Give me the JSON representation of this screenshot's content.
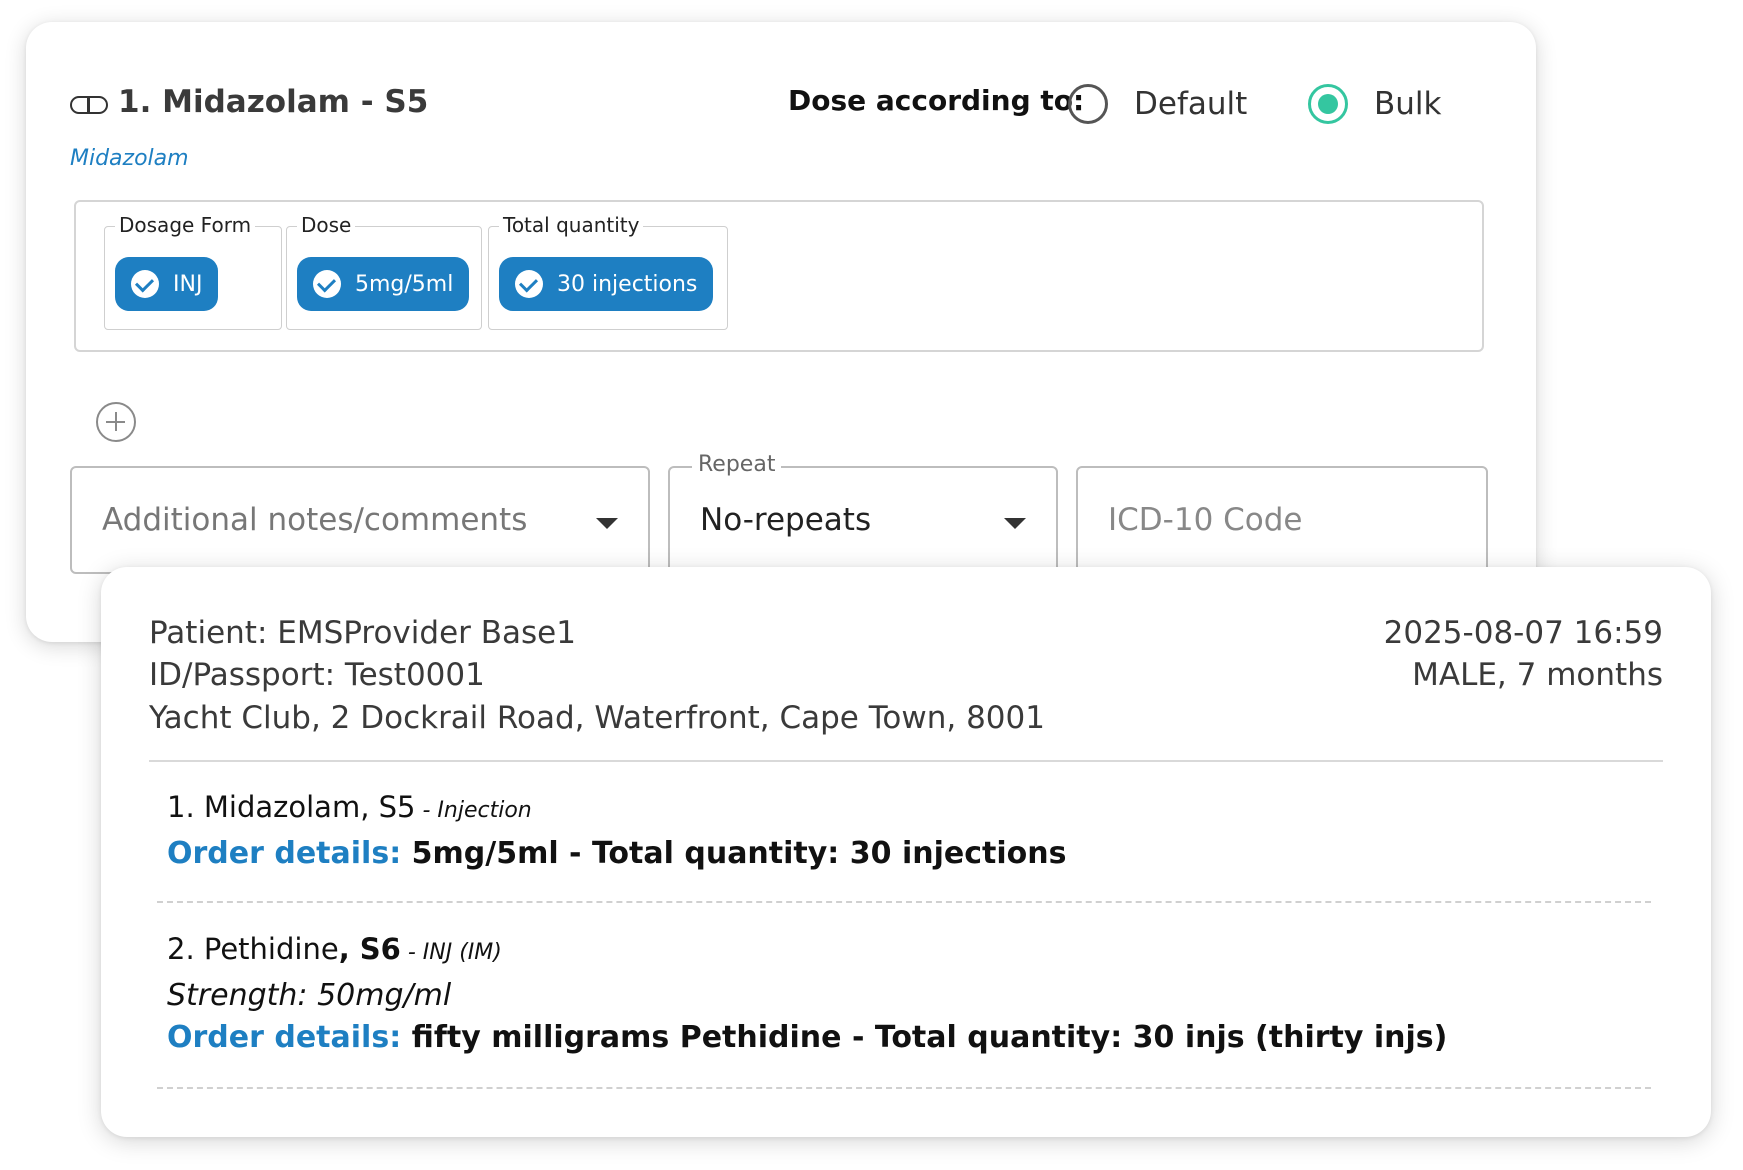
{
  "editor": {
    "med_title": "1. Midazolam - S5",
    "med_generic": "Midazolam",
    "dose_according_label": "Dose according to:",
    "dose_options": [
      {
        "label": "Default",
        "selected": false
      },
      {
        "label": "Bulk",
        "selected": true
      }
    ],
    "fields": {
      "dosage_form": {
        "legend": "Dosage Form",
        "value": "INJ"
      },
      "dose": {
        "legend": "Dose",
        "value": "5mg/5ml"
      },
      "total_quantity": {
        "legend": "Total quantity",
        "value": "30 injections"
      }
    },
    "notes_placeholder": "Additional notes/comments",
    "repeat": {
      "legend": "Repeat",
      "value": "No-repeats"
    },
    "icd_placeholder": "ICD-10 Code",
    "accent_color": "#1e7fc2",
    "radio_color": "#34c6a0"
  },
  "summary": {
    "patient_line": "Patient: EMSProvider Base1",
    "id_line": "ID/Passport: Test0001",
    "address_line": "Yacht Club, 2 Dockrail Road, Waterfront, Cape Town, 8001",
    "datetime": "2025-08-07 16:59",
    "sex_age": "MALE, 7 months",
    "items": [
      {
        "name": "1. Midazolam",
        "schedule": ", S5",
        "route": " - Injection",
        "order_label": "Order details:",
        "order_text": " 5mg/5ml - Total quantity: 30 injections"
      },
      {
        "name": "2. Pethidine",
        "schedule": ", S6",
        "route": " - INJ (IM)",
        "strength": "Strength: 50mg/ml",
        "order_label": "Order details:",
        "order_text": " fifty milligrams Pethidine - Total quantity: 30 injs (thirty injs)"
      }
    ]
  }
}
